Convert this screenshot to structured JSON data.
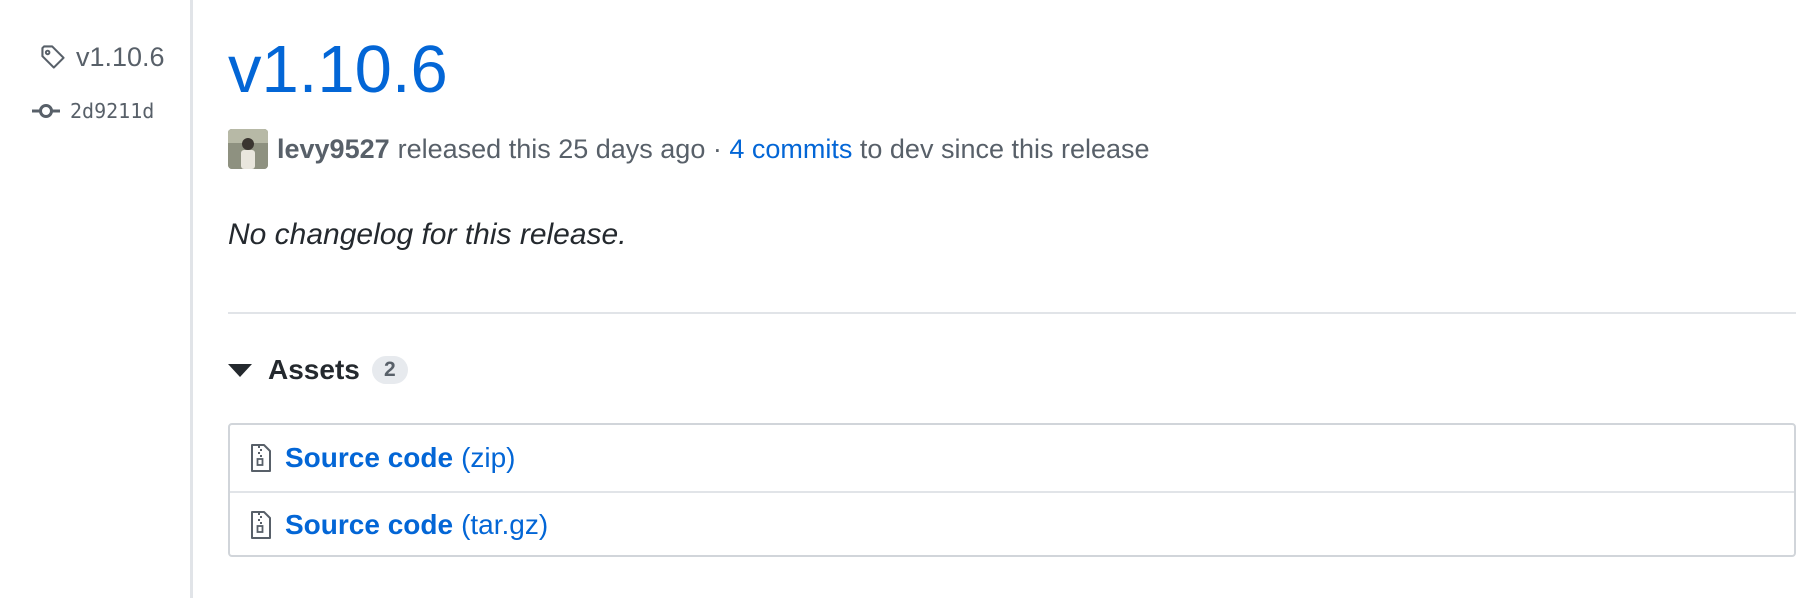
{
  "sidebar": {
    "tag_name": "v1.10.6",
    "commit_sha": "2d9211d"
  },
  "release": {
    "title": "v1.10.6",
    "author": "levy9527",
    "released_text": "released this 25 days ago",
    "separator": " · ",
    "commits_link": "4 commits",
    "since_text": "to dev since this release",
    "changelog": "No changelog for this release."
  },
  "assets": {
    "label": "Assets",
    "count": "2",
    "items": [
      {
        "name": "Source code",
        "ext": "(zip)"
      },
      {
        "name": "Source code",
        "ext": "(tar.gz)"
      }
    ]
  },
  "colors": {
    "link": "#0366d6",
    "text": "#24292e",
    "muted": "#586069",
    "border": "#e1e4e8"
  }
}
